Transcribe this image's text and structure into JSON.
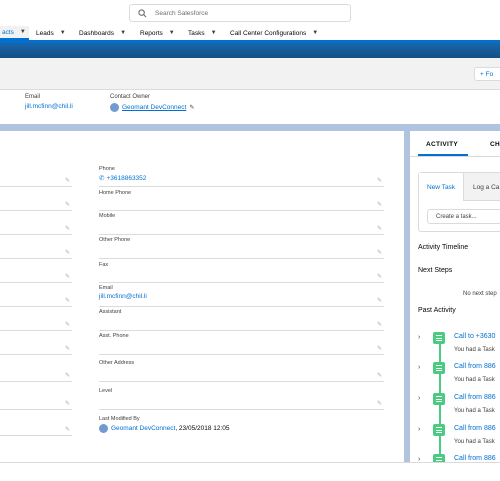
{
  "search": {
    "placeholder": "Search Salesforce"
  },
  "nav": {
    "items": [
      {
        "label": "acts",
        "active": true
      },
      {
        "label": "Leads"
      },
      {
        "label": "Dashboards"
      },
      {
        "label": "Reports"
      },
      {
        "label": "Tasks"
      },
      {
        "label": "Call Center Configurations"
      }
    ]
  },
  "header": {
    "follow_label": "+ Fo",
    "email_label": "Email",
    "email_value": "jill.mcfinn@chil.li",
    "owner_label": "Contact Owner",
    "owner_value": "Geomant DevConnect"
  },
  "detail": {
    "phone_label": "Phone",
    "phone_value": "+3618863352",
    "home_phone_label": "Home Phone",
    "mobile_label": "Mobile",
    "other_phone_label": "Other Phone",
    "fax_label": "Fax",
    "email_label": "Email",
    "email_value": "jill.mcfinn@chil.li",
    "assistant_label": "Assistant",
    "asst_phone_label": "Asst. Phone",
    "other_address_label": "Other Address",
    "level_label": "Level",
    "last_modified_label": "Last Modified By",
    "last_modified_user": "Geomant DevConnect",
    "last_modified_date": ", 23/05/2018 12:05"
  },
  "activity": {
    "tab_activity": "ACTIVITY",
    "tab_chatter": "CH",
    "new_task_tab": "New Task",
    "log_call_tab": "Log a Ca",
    "task_placeholder": "Create a task...",
    "timeline_title": "Activity Timeline",
    "next_steps": "Next Steps",
    "no_next_steps": "No next step",
    "past_activity": "Past Activity",
    "items": [
      {
        "title": "Call to +3630",
        "sub": "You had a Task"
      },
      {
        "title": "Call from 886",
        "sub": "You had a Task"
      },
      {
        "title": "Call from 886",
        "sub": "You had a Task"
      },
      {
        "title": "Call from 886",
        "sub": "You had a Task"
      },
      {
        "title": "Call from 886",
        "sub": ""
      }
    ]
  },
  "colors": {
    "brand_blue": "#0070d2",
    "activity_green": "#4bca81",
    "band": "#1b5f9e"
  }
}
